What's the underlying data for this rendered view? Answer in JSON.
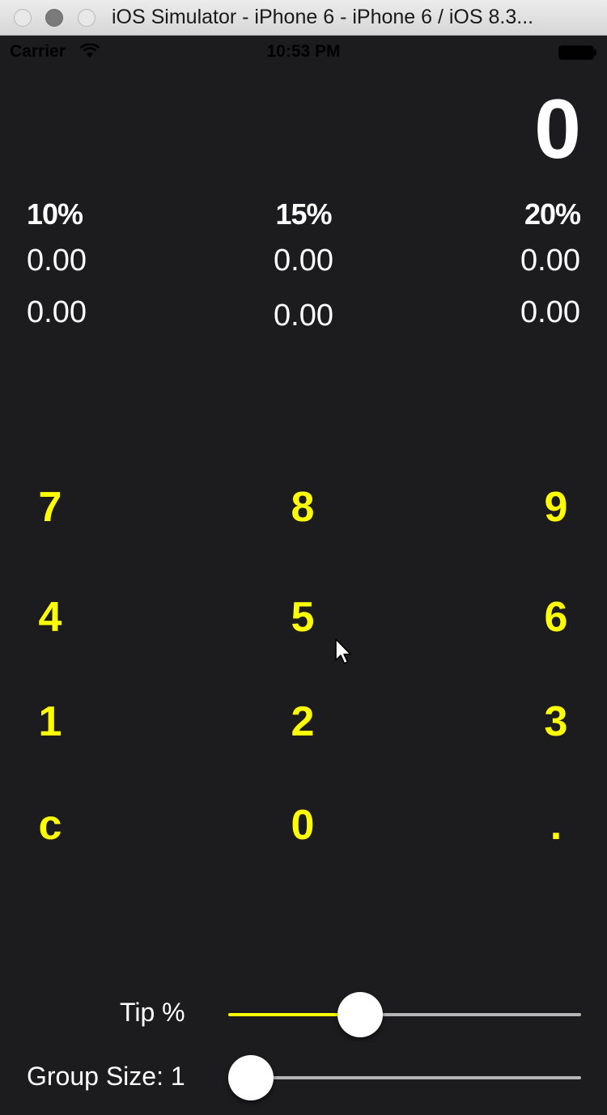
{
  "window": {
    "title": "iOS Simulator - iPhone 6 - iPhone 6 / iOS 8.3..."
  },
  "status_bar": {
    "carrier": "Carrier",
    "time": "10:53 PM"
  },
  "display": {
    "amount": "0"
  },
  "tip_columns": [
    {
      "percent": "10%",
      "tip": "0.00",
      "total": "0.00"
    },
    {
      "percent": "15%",
      "tip": "0.00",
      "total": "0.00"
    },
    {
      "percent": "20%",
      "tip": "0.00",
      "total": "0.00"
    }
  ],
  "keypad": {
    "keys": [
      "7",
      "8",
      "9",
      "4",
      "5",
      "6",
      "1",
      "2",
      "3",
      "c",
      "0",
      "."
    ]
  },
  "tip_slider": {
    "label": "Tip %",
    "fraction": 0.355
  },
  "group_slider": {
    "label": "Group Size: 1",
    "fraction": 0.0
  },
  "colors": {
    "background": "#1c1c1e",
    "accent": "#ffff00",
    "text": "#ffffff",
    "track_inactive": "#b5b5b5"
  }
}
